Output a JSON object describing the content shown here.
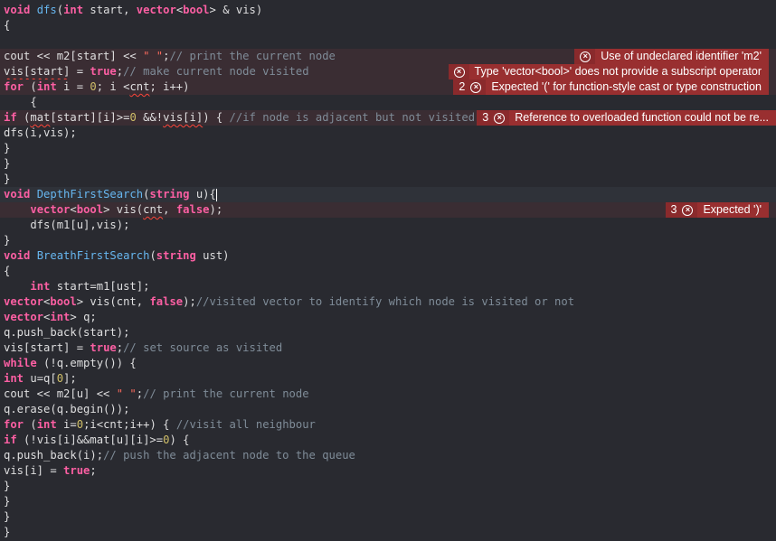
{
  "colors": {
    "background": "#292a30",
    "error_line": "#3a2d33",
    "error_badge": "#992f30",
    "keyword": "#fc5fa3",
    "function": "#67b7f0",
    "comment": "#7f8c98",
    "string": "#fc6a5d",
    "number": "#d0bf69",
    "text": "#dfdfe0"
  },
  "code": {
    "lines": [
      [
        [
          "kw",
          "void"
        ],
        [
          "tx",
          " "
        ],
        [
          "fn",
          "dfs"
        ],
        [
          "tx",
          "("
        ],
        [
          "kw",
          "int"
        ],
        [
          "tx",
          " start, "
        ],
        [
          "kw",
          "vector"
        ],
        [
          "tx",
          "<"
        ],
        [
          "kw",
          "bool"
        ],
        [
          "tx",
          "> & vis)"
        ]
      ],
      [
        [
          "tx",
          "{"
        ]
      ],
      [],
      [
        [
          "tx",
          "cout << m2[start] << "
        ],
        [
          "st",
          "\" \""
        ],
        [
          "tx",
          ";"
        ],
        [
          "cm",
          "// print the current node"
        ]
      ],
      [
        [
          "sq",
          "vis[start]"
        ],
        [
          "tx",
          " = "
        ],
        [
          "kw",
          "true"
        ],
        [
          "tx",
          ";"
        ],
        [
          "cm",
          "// make current node visited"
        ]
      ],
      [
        [
          "kw",
          "for"
        ],
        [
          "tx",
          " ("
        ],
        [
          "kw",
          "int"
        ],
        [
          "tx",
          " i = "
        ],
        [
          "nm",
          "0"
        ],
        [
          "tx",
          "; i <"
        ],
        [
          "sq",
          "cnt"
        ],
        [
          "tx",
          "; i++)"
        ]
      ],
      [
        [
          "tx",
          "    {"
        ]
      ],
      [
        [
          "kw",
          "if"
        ],
        [
          "tx",
          " ("
        ],
        [
          "sq",
          "mat"
        ],
        [
          "tx",
          "[start][i]>="
        ],
        [
          "nm",
          "0"
        ],
        [
          "tx",
          " &&!"
        ],
        [
          "sq",
          "vis[i]"
        ],
        [
          "tx",
          ") { "
        ],
        [
          "cm",
          "//if node is adjacent but not visited"
        ]
      ],
      [
        [
          "tx",
          "dfs(i,vis);"
        ]
      ],
      [
        [
          "tx",
          "}"
        ]
      ],
      [
        [
          "tx",
          "}"
        ]
      ],
      [
        [
          "tx",
          "}"
        ]
      ],
      [
        [
          "kw",
          "void"
        ],
        [
          "tx",
          " "
        ],
        [
          "fn",
          "DepthFirstSearch"
        ],
        [
          "tx",
          "("
        ],
        [
          "kw",
          "string"
        ],
        [
          "tx",
          " u){"
        ],
        [
          "caret",
          ""
        ]
      ],
      [
        [
          "tx",
          "    "
        ],
        [
          "kw",
          "vector"
        ],
        [
          "tx",
          "<"
        ],
        [
          "kw",
          "bool"
        ],
        [
          "tx",
          "> vis("
        ],
        [
          "sq",
          "cnt"
        ],
        [
          "tx",
          ", "
        ],
        [
          "kw",
          "false"
        ],
        [
          "tx",
          ");"
        ]
      ],
      [
        [
          "tx",
          "    dfs(m1[u],vis);"
        ]
      ],
      [
        [
          "tx",
          "}"
        ]
      ],
      [
        [
          "kw",
          "void"
        ],
        [
          "tx",
          " "
        ],
        [
          "fn",
          "BreathFirstSearch"
        ],
        [
          "tx",
          "("
        ],
        [
          "kw",
          "string"
        ],
        [
          "tx",
          " ust)"
        ]
      ],
      [
        [
          "tx",
          "{"
        ]
      ],
      [
        [
          "tx",
          "    "
        ],
        [
          "kw",
          "int"
        ],
        [
          "tx",
          " start=m1[ust];"
        ]
      ],
      [
        [
          "kw",
          "vector"
        ],
        [
          "tx",
          "<"
        ],
        [
          "kw",
          "bool"
        ],
        [
          "tx",
          "> vis(cnt, "
        ],
        [
          "kw",
          "false"
        ],
        [
          "tx",
          ");"
        ],
        [
          "cm",
          "//visited vector to identify which node is visited or not"
        ]
      ],
      [
        [
          "kw",
          "vector"
        ],
        [
          "tx",
          "<"
        ],
        [
          "kw",
          "int"
        ],
        [
          "tx",
          "> q;"
        ]
      ],
      [
        [
          "tx",
          "q.push_back(start);"
        ]
      ],
      [
        [
          "tx",
          "vis[start] = "
        ],
        [
          "kw",
          "true"
        ],
        [
          "tx",
          ";"
        ],
        [
          "cm",
          "// set source as visited"
        ]
      ],
      [
        [
          "kw",
          "while"
        ],
        [
          "tx",
          " (!q.empty()) {"
        ]
      ],
      [
        [
          "kw",
          "int"
        ],
        [
          "tx",
          " u=q["
        ],
        [
          "nm",
          "0"
        ],
        [
          "tx",
          "];"
        ]
      ],
      [
        [
          "tx",
          "cout << m2[u] << "
        ],
        [
          "st",
          "\" \""
        ],
        [
          "tx",
          ";"
        ],
        [
          "cm",
          "// print the current node"
        ]
      ],
      [
        [
          "tx",
          "q.erase(q.begin());"
        ]
      ],
      [
        [
          "kw",
          "for"
        ],
        [
          "tx",
          " ("
        ],
        [
          "kw",
          "int"
        ],
        [
          "tx",
          " i="
        ],
        [
          "nm",
          "0"
        ],
        [
          "tx",
          ";i<cnt;i++) { "
        ],
        [
          "cm",
          "//visit all neighbour"
        ]
      ],
      [
        [
          "kw",
          "if"
        ],
        [
          "tx",
          " (!vis[i]&&mat[u][i]>="
        ],
        [
          "nm",
          "0"
        ],
        [
          "tx",
          ") {"
        ]
      ],
      [
        [
          "tx",
          "q.push_back(i);"
        ],
        [
          "cm",
          "// push the adjacent node to the queue"
        ]
      ],
      [
        [
          "tx",
          "vis[i] = "
        ],
        [
          "kw",
          "true"
        ],
        [
          "tx",
          ";"
        ]
      ],
      [
        [
          "tx",
          "}"
        ]
      ],
      [
        [
          "tx",
          "}"
        ]
      ],
      [
        [
          "tx",
          "}"
        ]
      ],
      [
        [
          "tx",
          "}"
        ]
      ]
    ],
    "error_lines": [
      3,
      4,
      5,
      7,
      13
    ],
    "current_line": 12
  },
  "errors": [
    {
      "line": 3,
      "count": "",
      "message": "Use of undeclared identifier 'm2'"
    },
    {
      "line": 4,
      "count": "",
      "message": "Type 'vector<bool>' does not provide a subscript operator"
    },
    {
      "line": 5,
      "count": "2",
      "message": "Expected '(' for function-style cast or type construction"
    },
    {
      "line": 7,
      "count": "3",
      "message": "Reference to overloaded function could not be re..."
    },
    {
      "line": 13,
      "count": "3",
      "message": "Expected ')'"
    }
  ]
}
